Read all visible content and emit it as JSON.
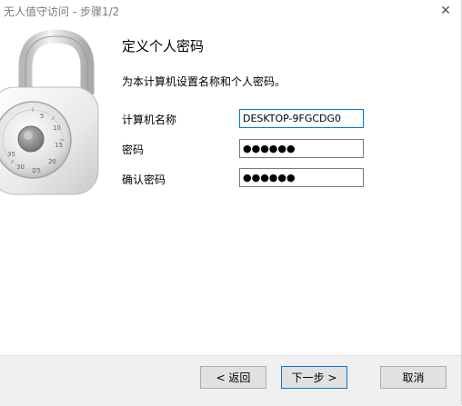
{
  "window": {
    "title": "无人值守访问 - 步骤1/2",
    "close_glyph": "✕"
  },
  "content": {
    "heading": "定义个人密码",
    "description": "为本计算机设置名称和个人密码。"
  },
  "form": {
    "computer_name_label": "计算机名称",
    "computer_name_value": "DESKTOP-9FGCDG0",
    "password_label": "密码",
    "password_value": "●●●●●●",
    "confirm_label": "确认密码",
    "confirm_value": "●●●●●●"
  },
  "buttons": {
    "back": "< 返回",
    "next": "下一步 >",
    "cancel": "取消"
  },
  "icons": {
    "lock": "padlock-icon"
  }
}
